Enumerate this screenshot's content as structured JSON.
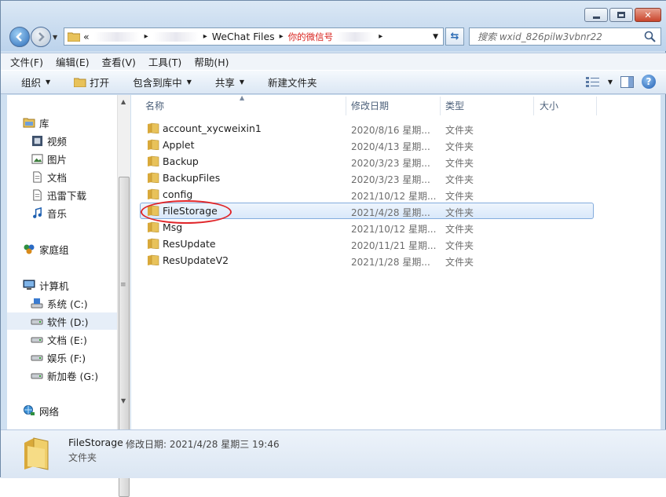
{
  "window": {
    "controls": {
      "minimize": "minimize-icon",
      "maximize": "maximize-icon",
      "close": "✕"
    }
  },
  "address": {
    "prefix": "«",
    "segment_main": "WeChat Files",
    "segment_annotation": "你的微信号",
    "segment_end": ""
  },
  "search": {
    "placeholder": "搜索 wxid_826pilw3vbnr22"
  },
  "menu": [
    {
      "label": "文件(F)"
    },
    {
      "label": "编辑(E)"
    },
    {
      "label": "查看(V)"
    },
    {
      "label": "工具(T)"
    },
    {
      "label": "帮助(H)"
    }
  ],
  "toolbar": {
    "organize": "组织",
    "open": "打开",
    "include_library": "包含到库中",
    "share": "共享",
    "new_folder": "新建文件夹"
  },
  "nav": {
    "libraries": "库",
    "videos": "视频",
    "pictures": "图片",
    "documents": "文档",
    "thunder": "迅雷下载",
    "music": "音乐",
    "homegroup": "家庭组",
    "computer": "计算机",
    "drive_c": "系统 (C:)",
    "drive_d": "软件 (D:)",
    "drive_e": "文档 (E:)",
    "drive_f": "娱乐 (F:)",
    "drive_g": "新加卷 (G:)",
    "network": "网络"
  },
  "columns": {
    "name": "名称",
    "date": "修改日期",
    "type": "类型",
    "size": "大小"
  },
  "files": [
    {
      "name": "account_xycweixin1",
      "date": "2020/8/16 星期...",
      "type": "文件夹"
    },
    {
      "name": "Applet",
      "date": "2020/4/13 星期...",
      "type": "文件夹"
    },
    {
      "name": "Backup",
      "date": "2020/3/23 星期...",
      "type": "文件夹"
    },
    {
      "name": "BackupFiles",
      "date": "2020/3/23 星期...",
      "type": "文件夹"
    },
    {
      "name": "config",
      "date": "2021/10/12 星期...",
      "type": "文件夹"
    },
    {
      "name": "FileStorage",
      "date": "2021/4/28 星期...",
      "type": "文件夹"
    },
    {
      "name": "Msg",
      "date": "2021/10/12 星期...",
      "type": "文件夹"
    },
    {
      "name": "ResUpdate",
      "date": "2020/11/21 星期...",
      "type": "文件夹"
    },
    {
      "name": "ResUpdateV2",
      "date": "2021/1/28 星期...",
      "type": "文件夹"
    }
  ],
  "selected_index": 5,
  "details": {
    "name": "FileStorage",
    "date_label": "修改日期: 2021/4/28 星期三 19:46",
    "type": "文件夹"
  },
  "colors": {
    "highlight": "#e0262a",
    "folder": "#e8c25a",
    "selection": "#d9e8fa"
  }
}
